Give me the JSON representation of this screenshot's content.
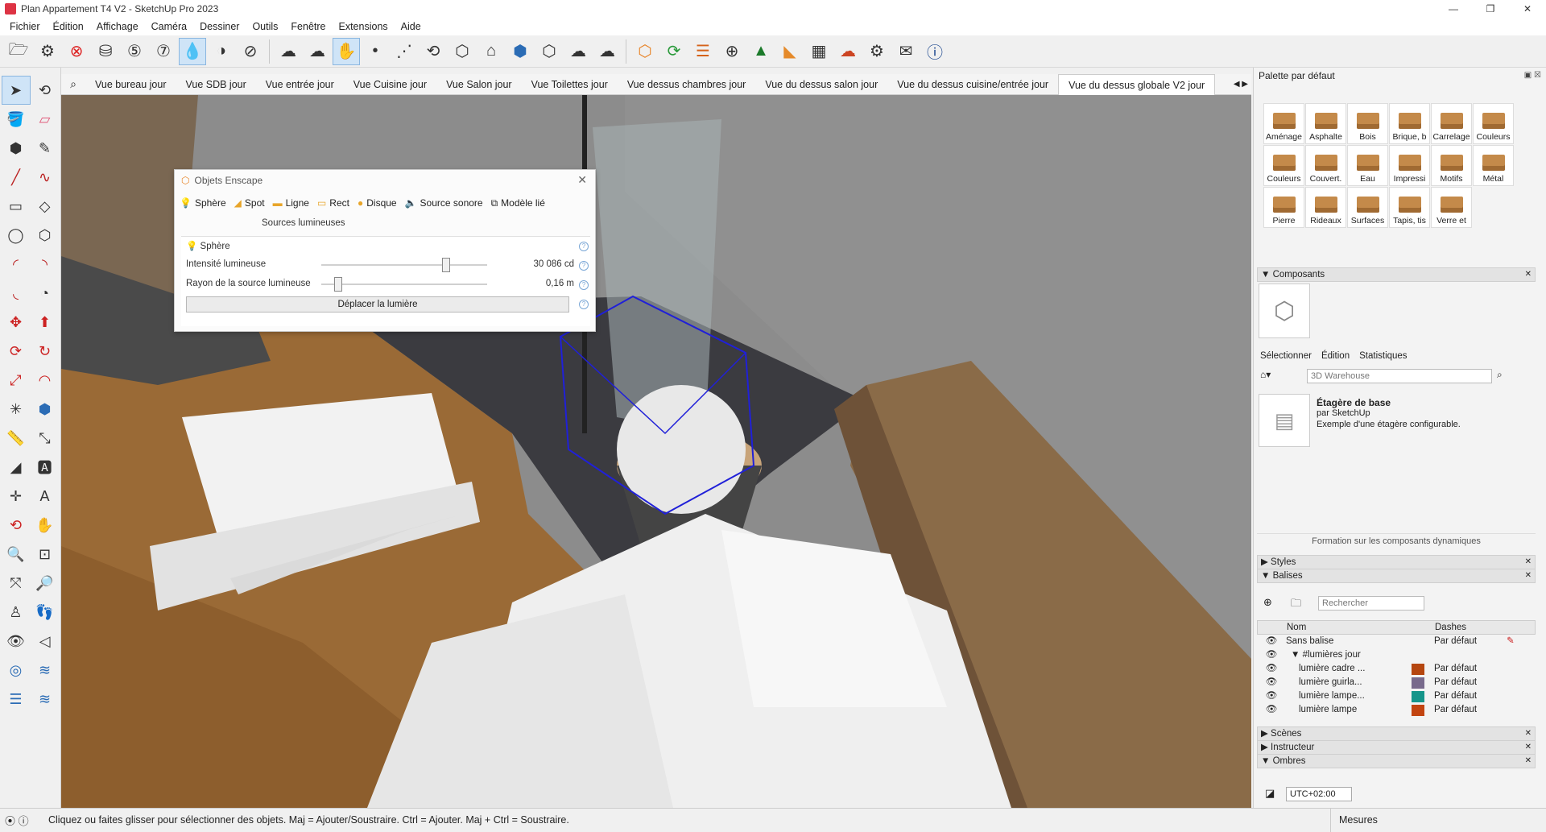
{
  "window": {
    "title": "Plan Appartement T4 V2 - SketchUp Pro 2023",
    "controls": [
      "—",
      "❐",
      "✕"
    ]
  },
  "menu": [
    "Fichier",
    "Édition",
    "Affichage",
    "Caméra",
    "Dessiner",
    "Outils",
    "Fenêtre",
    "Extensions",
    "Aide"
  ],
  "scene_tabs": [
    "Vue bureau jour",
    "Vue SDB jour",
    "Vue entrée jour",
    "Vue Cuisine jour",
    "Vue Salon  jour",
    "Vue Toilettes jour",
    "Vue dessus chambres jour",
    "Vue du dessus salon jour",
    "Vue du dessus cuisine/entrée jour",
    "Vue du dessus globale V2 jour"
  ],
  "enscape_dialog": {
    "title": "Objets Enscape",
    "close": "✕",
    "types": [
      "Sphère",
      "Spot",
      "Ligne",
      "Rect",
      "Disque",
      "Source sonore",
      "Modèle lié"
    ],
    "sources_label": "Sources lumineuses",
    "group_label": "Sphère",
    "intensity_label": "Intensité lumineuse",
    "intensity_value": "30 086 cd",
    "intensity_fraction": 0.75,
    "radius_label": "Rayon de la source lumineuse",
    "radius_value": "0,16 m",
    "radius_fraction": 0.1,
    "move_button": "Déplacer la lumière",
    "help": "?"
  },
  "right_panel": {
    "title": "Palette par défaut",
    "materials": [
      "Aménage",
      "Asphalte",
      "Bois",
      "Brique, b",
      "Carrelage",
      "Couleurs",
      "Couleurs",
      "Couvert.",
      "Eau",
      "Impressi",
      "Motifs",
      "Métal",
      "Pierre",
      "Rideaux",
      "Surfaces",
      "Tapis, tis",
      "Verre et"
    ],
    "components": {
      "header": "Composants",
      "tabs": [
        "Sélectionner",
        "Édition",
        "Statistiques"
      ],
      "search_value": "3D Warehouse",
      "item_name": "Étagère de base",
      "item_by": "par SketchUp",
      "item_desc": "Exemple d'une étagère configurable.",
      "formation": "Formation sur les composants dynamiques"
    },
    "styles_header": "Styles",
    "tags": {
      "header": "Balises",
      "search_placeholder": "Rechercher",
      "col_name": "Nom",
      "col_dashes": "Dashes",
      "rows": [
        {
          "name": "Sans balise",
          "dash": "Par défaut",
          "color": ""
        },
        {
          "name": "▼ #lumières jour",
          "dash": "",
          "color": ""
        },
        {
          "name": "lumière cadre ...",
          "dash": "Par défaut",
          "color": "#b5460f"
        },
        {
          "name": "lumière guirla...",
          "dash": "Par défaut",
          "color": "#786a8c"
        },
        {
          "name": "lumière lampe...",
          "dash": "Par défaut",
          "color": "#15958a"
        },
        {
          "name": "lumière lampe",
          "dash": "Par défaut",
          "color": "#c24410"
        }
      ]
    },
    "scenes_header": "Scènes",
    "instructor_header": "Instructeur",
    "shadows_header": "Ombres",
    "timezone": "UTC+02:00"
  },
  "status": {
    "message": "Cliquez ou faites glisser pour sélectionner des objets. Maj = Ajouter/Soustraire. Ctrl = Ajouter. Maj + Ctrl = Soustraire.",
    "measure_label": "Mesures"
  }
}
